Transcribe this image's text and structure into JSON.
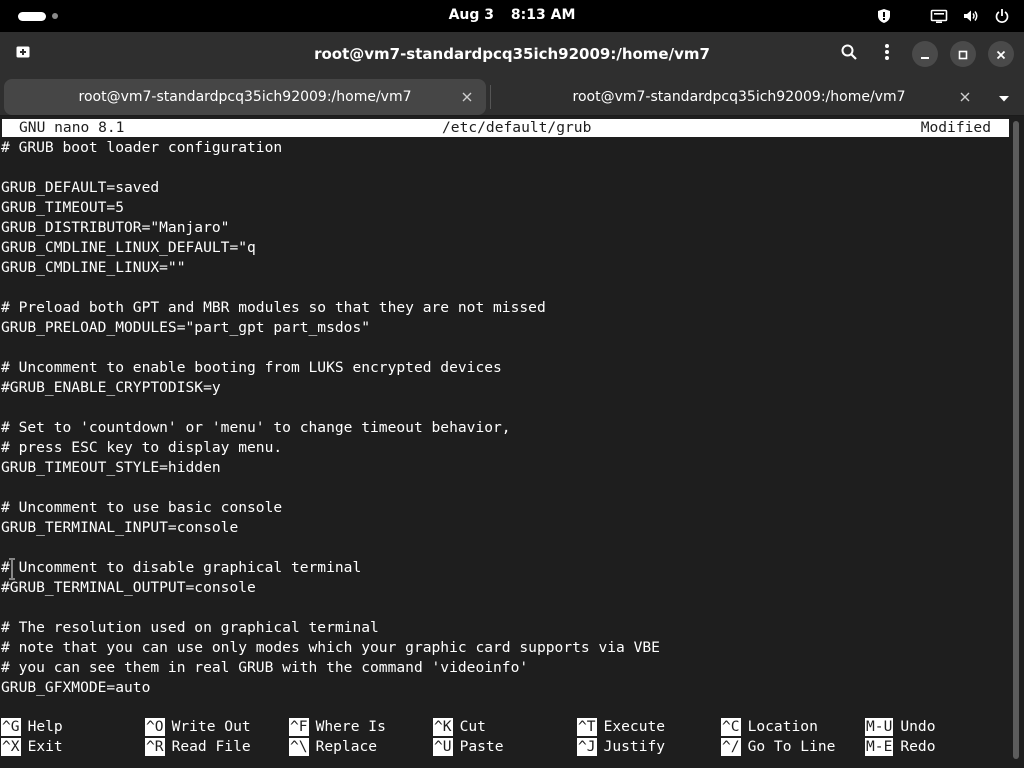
{
  "system_bar": {
    "date": "Aug 3",
    "time": "8:13 AM",
    "icons": [
      "shield-icon",
      "screen-icon",
      "volume-icon",
      "power-icon"
    ]
  },
  "window": {
    "title": "root@vm7-standardpcq35ich92009:/home/vm7",
    "icons": [
      "new-tab-icon",
      "search-icon",
      "kebab-menu-icon",
      "minimize-icon",
      "maximize-icon",
      "close-icon"
    ]
  },
  "tabs": [
    {
      "label": "root@vm7-standardpcq35ich92009:/home/vm7",
      "active": true
    },
    {
      "label": "root@vm7-standardpcq35ich92009:/home/vm7",
      "active": false
    }
  ],
  "nano": {
    "version": "GNU nano 8.1",
    "file": "/etc/default/grub",
    "status": "Modified",
    "lines": [
      "# GRUB boot loader configuration",
      "",
      "GRUB_DEFAULT=saved",
      "GRUB_TIMEOUT=5",
      "GRUB_DISTRIBUTOR=\"Manjaro\"",
      "GRUB_CMDLINE_LINUX_DEFAULT=\"q",
      "GRUB_CMDLINE_LINUX=\"\"",
      "",
      "# Preload both GPT and MBR modules so that they are not missed",
      "GRUB_PRELOAD_MODULES=\"part_gpt part_msdos\"",
      "",
      "# Uncomment to enable booting from LUKS encrypted devices",
      "#GRUB_ENABLE_CRYPTODISK=y",
      "",
      "# Set to 'countdown' or 'menu' to change timeout behavior,",
      "# press ESC key to display menu.",
      "GRUB_TIMEOUT_STYLE=hidden",
      "",
      "# Uncomment to use basic console",
      "GRUB_TERMINAL_INPUT=console",
      "",
      "# Uncomment to disable graphical terminal",
      "#GRUB_TERMINAL_OUTPUT=console",
      "",
      "# The resolution used on graphical terminal",
      "# note that you can use only modes which your graphic card supports via VBE",
      "# you can see them in real GRUB with the command 'videoinfo'",
      "GRUB_GFXMODE=auto"
    ],
    "shortcuts": [
      [
        {
          "key": "^G",
          "label": "Help"
        },
        {
          "key": "^O",
          "label": "Write Out"
        },
        {
          "key": "^F",
          "label": "Where Is"
        },
        {
          "key": "^K",
          "label": "Cut"
        },
        {
          "key": "^T",
          "label": "Execute"
        },
        {
          "key": "^C",
          "label": "Location"
        },
        {
          "key": "M-U",
          "label": "Undo"
        }
      ],
      [
        {
          "key": "^X",
          "label": "Exit"
        },
        {
          "key": "^R",
          "label": "Read File"
        },
        {
          "key": "^\\",
          "label": "Replace"
        },
        {
          "key": "^U",
          "label": "Paste"
        },
        {
          "key": "^J",
          "label": "Justify"
        },
        {
          "key": "^/",
          "label": "Go To Line"
        },
        {
          "key": "M-E",
          "label": "Redo"
        }
      ]
    ]
  }
}
